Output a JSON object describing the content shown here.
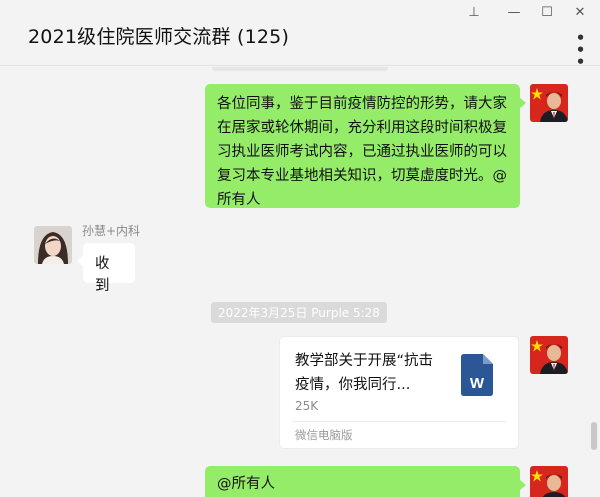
{
  "window": {
    "title": "2021级住院医师交流群 (125)",
    "controls": {
      "pin": "⊥",
      "minimize": "—",
      "maximize": "☐",
      "close": "✕"
    },
    "more": "• • •"
  },
  "messages": [
    {
      "type": "text",
      "side": "me",
      "text": "各位同事，鉴于目前疫情防控的形势，请大家在居家或轮休期间，充分利用这段时间积极复习执业医师考试内容，已通过执业医师的可以复习本专业基地相关知识，切莫虚度时光。@所有人"
    },
    {
      "type": "text",
      "side": "other",
      "sender": "孙慧+内科",
      "text": "收到"
    },
    {
      "type": "timestamp",
      "text": "2022年3月25日 Purple 5:28"
    },
    {
      "type": "file",
      "side": "me",
      "file_name": "教学部关于开展“抗击疫情，你我同行...",
      "file_size": "25K",
      "source": "微信电脑版",
      "file_icon": "word-doc-icon"
    },
    {
      "type": "text",
      "side": "me",
      "text": "@所有人"
    }
  ],
  "colors": {
    "bubble_me": "#95ec69",
    "bubble_other": "#ffffff",
    "background": "#f3f3f3",
    "word_blue": "#2b5797"
  }
}
